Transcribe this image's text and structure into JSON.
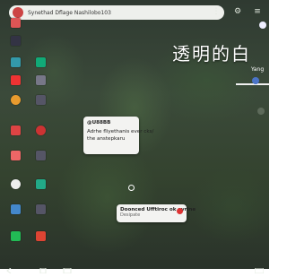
{
  "search": {
    "text": "Synethad Dflage Nashilobo103"
  },
  "wallpaper": {
    "title": "透明的白",
    "label": "Yang"
  },
  "widget1": {
    "heading": "@U88BB",
    "lines": [
      "Adrhe fliyethanis ever cks/",
      "the anstepkaru"
    ]
  },
  "widget2": {
    "heading": "Doonced Ufftiroc ok ayrine",
    "sub": "Desipate"
  },
  "colors": {
    "search_icon": "#cc4444",
    "badge": "#d33333"
  }
}
